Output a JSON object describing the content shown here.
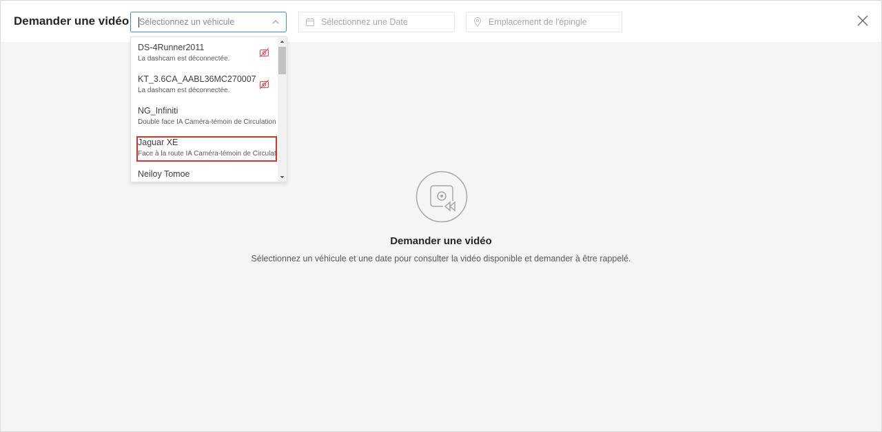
{
  "header": {
    "title": "Demander une vidéo",
    "vehicle_placeholder": "Sélectionnez un véhicule",
    "date_placeholder": "Sélectionnez une Date",
    "pin_placeholder": "Emplacement de l'épingle"
  },
  "dropdown": {
    "options": [
      {
        "name": "DS-4Runner2011",
        "sub": "La dashcam est déconnectée.",
        "status_icon": "camera-off-icon"
      },
      {
        "name": "KT_3.6CA_AABL36MC270007",
        "sub": "La dashcam est déconnectée.",
        "status_icon": "camera-off-icon"
      },
      {
        "name": "NG_Infiniti",
        "sub": "Double face IA Caméra-témoin de Circulation"
      },
      {
        "name": "Jaguar XE",
        "sub": "Face à la route IA Caméra-témoin de Circulation"
      },
      {
        "name": "Neiloy Tomoe",
        "sub": ""
      }
    ]
  },
  "empty_state": {
    "title": "Demander une vidéo",
    "description": "Sélectionnez un véhicule et une date pour consulter la vidéo disponible et demander à être rappelé."
  },
  "colors": {
    "accent": "#3b8ee0",
    "offline": "#e0474c",
    "highlight": "#d0342c"
  }
}
